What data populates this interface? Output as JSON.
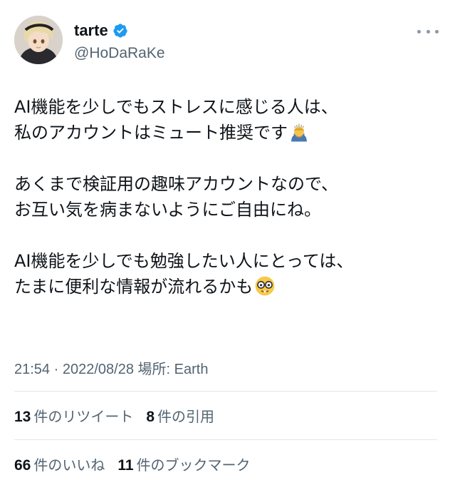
{
  "user": {
    "display_name": "tarte",
    "handle": "@HoDaRaKe"
  },
  "tweet": {
    "paragraphs": [
      {
        "lines": [
          "AI機能を少しでもストレスに感じる人は、",
          "私のアカウントはミュート推奨です"
        ],
        "emoji": "person-bowing-emoji"
      },
      {
        "lines": [
          "あくまで検証用の趣味アカウントなので、",
          "お互い気を病まないようにご自由にね。"
        ]
      },
      {
        "lines": [
          "AI機能を少しでも勉強したい人にとっては、",
          "たまに便利な情報が流れるかも"
        ],
        "emoji": "nerd-face-emoji"
      }
    ],
    "time": "21:54",
    "separator": " · ",
    "date": "2022/08/28",
    "location_label": "場所: ",
    "location": "Earth"
  },
  "stats": {
    "retweets": {
      "count": "13",
      "label": "件のリツイート"
    },
    "quotes": {
      "count": "8",
      "label": "件の引用"
    },
    "likes": {
      "count": "66",
      "label": "件のいいね"
    },
    "bookmarks": {
      "count": "11",
      "label": "件のブックマーク"
    }
  },
  "colors": {
    "text": "#0f1419",
    "secondary": "#536471",
    "verified": "#1d9bf0",
    "divider": "#e1e8ed"
  }
}
